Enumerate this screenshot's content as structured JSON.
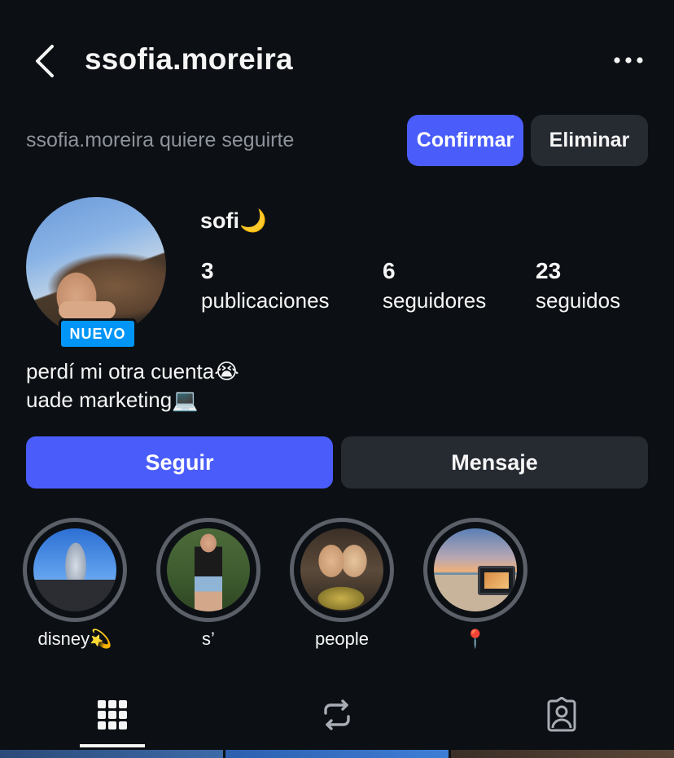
{
  "header": {
    "username": "ssofia.moreira",
    "back_icon": "chevron-left-icon",
    "more_icon": "more-horizontal-icon"
  },
  "follow_request": {
    "text": "ssofia.moreira quiere seguirte",
    "confirm_label": "Confirmar",
    "delete_label": "Eliminar"
  },
  "profile": {
    "display_name": "sofi🌙",
    "badge": "NUEVO",
    "stats": [
      {
        "value": "3",
        "label": "publicaciones"
      },
      {
        "value": "6",
        "label": "seguidores"
      },
      {
        "value": "23",
        "label": "seguidos"
      }
    ],
    "bio": [
      "perdí mi otra cuenta😭",
      "uade marketing💻"
    ]
  },
  "actions": {
    "follow_label": "Seguir",
    "message_label": "Mensaje"
  },
  "highlights": [
    {
      "label": "disney💫"
    },
    {
      "label": "s’"
    },
    {
      "label": "people"
    },
    {
      "label": "📍"
    }
  ],
  "tabs": [
    {
      "icon": "grid-icon",
      "selected": true
    },
    {
      "icon": "reels-repost-icon",
      "selected": false
    },
    {
      "icon": "tagged-person-icon",
      "selected": false
    }
  ],
  "colors": {
    "background": "#0c1014",
    "accent": "#4a5dfb",
    "secondary_button": "#262a31",
    "badge": "#0095f6",
    "muted_text": "#8e939b"
  }
}
